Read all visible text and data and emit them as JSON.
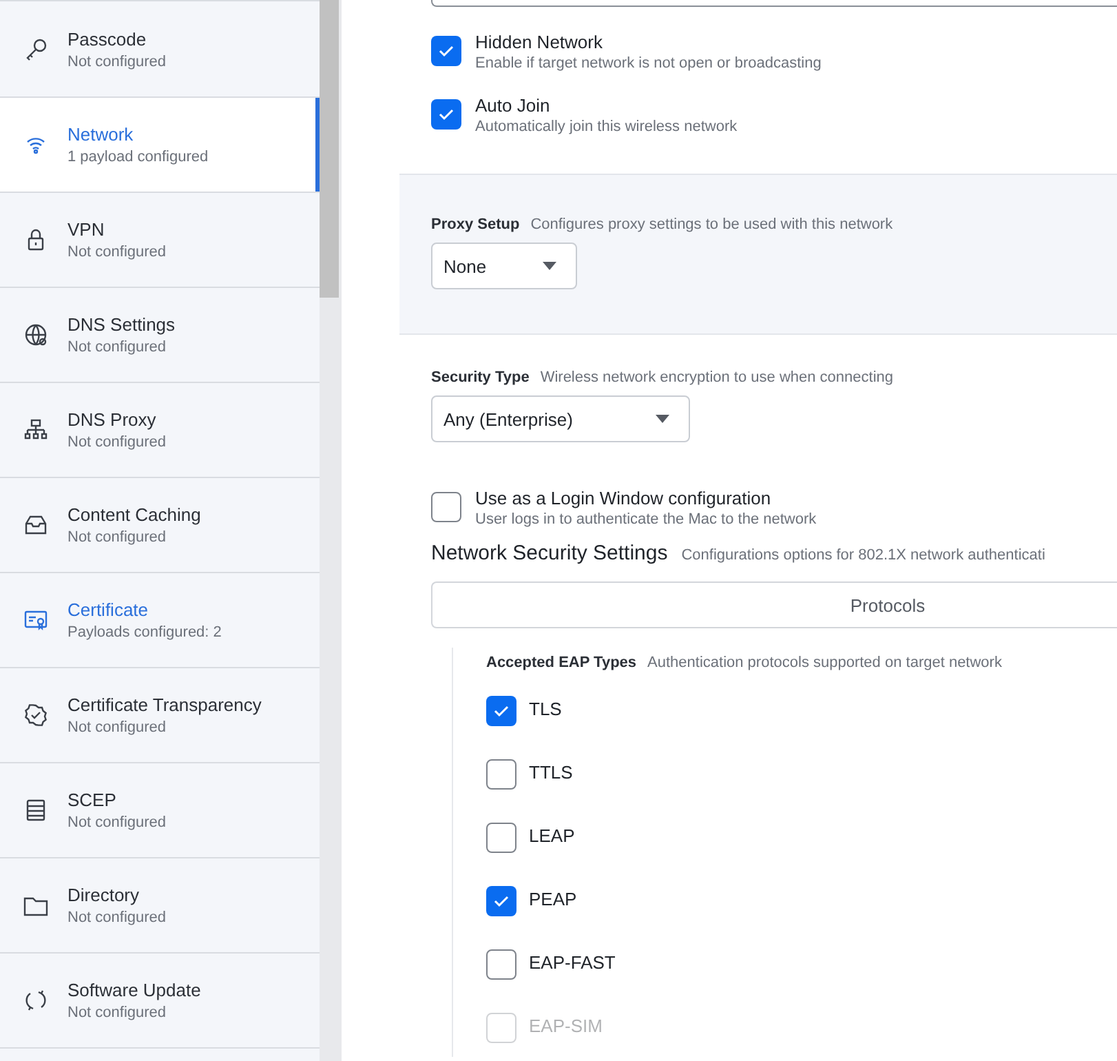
{
  "sidebar": {
    "items": [
      {
        "title": "Passcode",
        "subtitle": "Not configured",
        "selected": false,
        "configured": false
      },
      {
        "title": "Network",
        "subtitle": "1 payload configured",
        "selected": true,
        "configured": true
      },
      {
        "title": "VPN",
        "subtitle": "Not configured",
        "selected": false,
        "configured": false
      },
      {
        "title": "DNS Settings",
        "subtitle": "Not configured",
        "selected": false,
        "configured": false
      },
      {
        "title": "DNS Proxy",
        "subtitle": "Not configured",
        "selected": false,
        "configured": false
      },
      {
        "title": "Content Caching",
        "subtitle": "Not configured",
        "selected": false,
        "configured": false
      },
      {
        "title": "Certificate",
        "subtitle": "Payloads configured: 2",
        "selected": false,
        "configured": true
      },
      {
        "title": "Certificate Transparency",
        "subtitle": "Not configured",
        "selected": false,
        "configured": false
      },
      {
        "title": "SCEP",
        "subtitle": "Not configured",
        "selected": false,
        "configured": false
      },
      {
        "title": "Directory",
        "subtitle": "Not configured",
        "selected": false,
        "configured": false
      },
      {
        "title": "Software Update",
        "subtitle": "Not configured",
        "selected": false,
        "configured": false
      }
    ]
  },
  "options": [
    {
      "label": "Hidden Network",
      "description": "Enable if target network is not open or broadcasting",
      "checked": true
    },
    {
      "label": "Auto Join",
      "description": "Automatically join this wireless network",
      "checked": true
    }
  ],
  "proxy": {
    "label": "Proxy Setup",
    "description": "Configures proxy settings to be used with this network",
    "value": "None"
  },
  "security": {
    "label": "Security Type",
    "description": "Wireless network encryption to use when connecting",
    "value": "Any (Enterprise)"
  },
  "login_window": {
    "label": "Use as a Login Window configuration",
    "description": "User logs in to authenticate the Mac to the network",
    "checked": false
  },
  "network_security": {
    "title": "Network Security Settings",
    "description": "Configurations options for 802.1X network authenticati",
    "tab": "Protocols"
  },
  "eap": {
    "label": "Accepted EAP Types",
    "description": "Authentication protocols supported on target network",
    "types": [
      {
        "label": "TLS",
        "checked": true
      },
      {
        "label": "TTLS",
        "checked": false
      },
      {
        "label": "LEAP",
        "checked": false
      },
      {
        "label": "PEAP",
        "checked": true
      },
      {
        "label": "EAP-FAST",
        "checked": false
      },
      {
        "label": "EAP-SIM",
        "checked": false
      }
    ]
  }
}
